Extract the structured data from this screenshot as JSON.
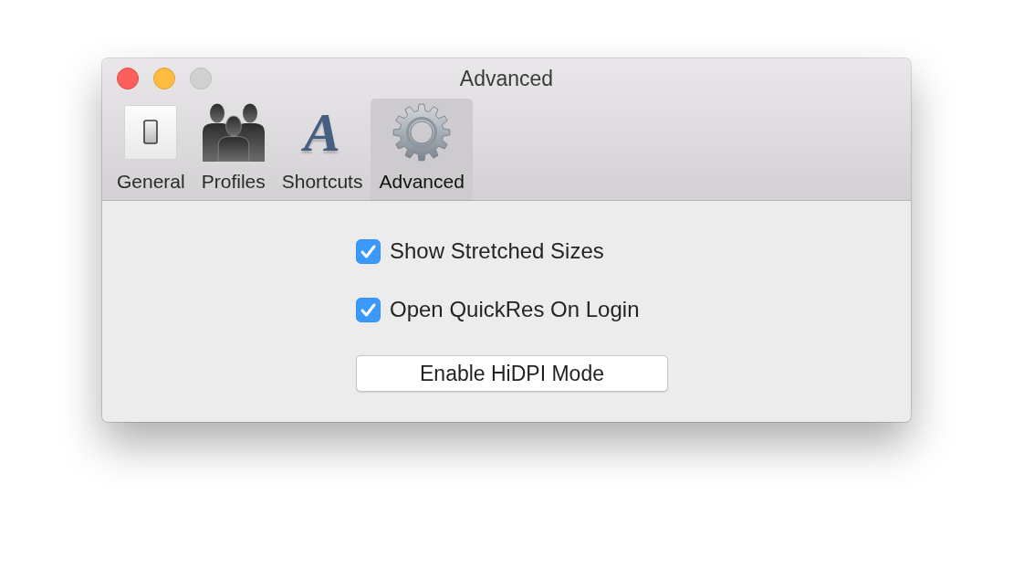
{
  "window": {
    "title": "Advanced",
    "window_controls": [
      {
        "kind": "close",
        "disabled": false
      },
      {
        "kind": "minimize",
        "disabled": false
      },
      {
        "kind": "zoom",
        "disabled": true
      }
    ]
  },
  "tabs": [
    {
      "label": "General",
      "kind": "switch",
      "selected": false
    },
    {
      "label": "Profiles",
      "kind": "people",
      "selected": false
    },
    {
      "label": "Shortcuts",
      "kind": "letter",
      "glyph": "A",
      "selected": false
    },
    {
      "label": "Advanced",
      "kind": "gear",
      "selected": true
    }
  ],
  "options": [
    {
      "label": "Show Stretched Sizes",
      "checked": true
    },
    {
      "label": "Open QuickRes On Login",
      "checked": true
    }
  ],
  "buttons": [
    {
      "label": "Enable HiDPI Mode"
    }
  ]
}
